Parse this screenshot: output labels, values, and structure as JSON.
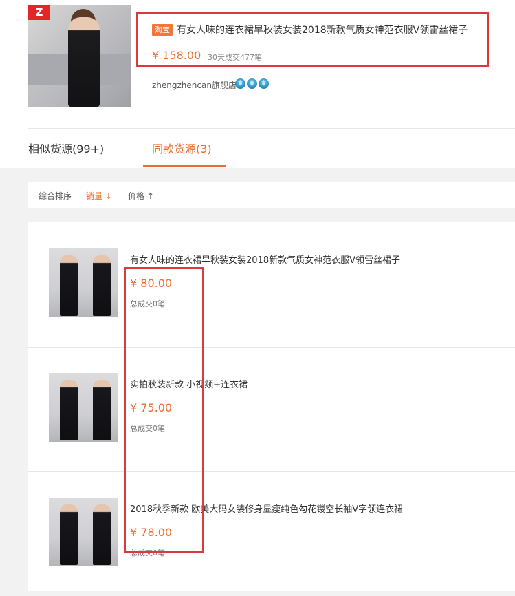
{
  "product": {
    "store_logo": "Z",
    "badge": "淘宝",
    "title": "有女人味的连衣裙早秋装女装2018新款气质女神范衣服V领雷丝裙子",
    "price": "¥ 158.00",
    "sales": "30天成交477笔",
    "shop": "zhengzhencan旗舰店",
    "crown_icon": "♛",
    "crown_count": 3
  },
  "tabs": [
    {
      "label": "相似货源(99+)",
      "active": false
    },
    {
      "label": "同款货源(3)",
      "active": true
    }
  ],
  "sort": {
    "general": "综合排序",
    "sales": "销量 ↓",
    "price": "价格 ↑"
  },
  "items": [
    {
      "title": "有女人味的连衣裙早秋装女装2018新款气质女神范衣服V领雷丝裙子",
      "price": "¥ 80.00",
      "sales": "总成交0笔"
    },
    {
      "title": "实拍秋装新款 小视频+连衣裙",
      "price": "¥ 75.00",
      "sales": "总成交0笔"
    },
    {
      "title": "2018秋季新款 欧美大码女装修身显瘦纯色勾花镂空长袖V字领连衣裙",
      "price": "¥ 78.00",
      "sales": "总成交0笔"
    }
  ],
  "colors": {
    "accent": "#ee6c2c",
    "highlight_border": "#d9393f",
    "badge_bg": "#f2763a"
  }
}
